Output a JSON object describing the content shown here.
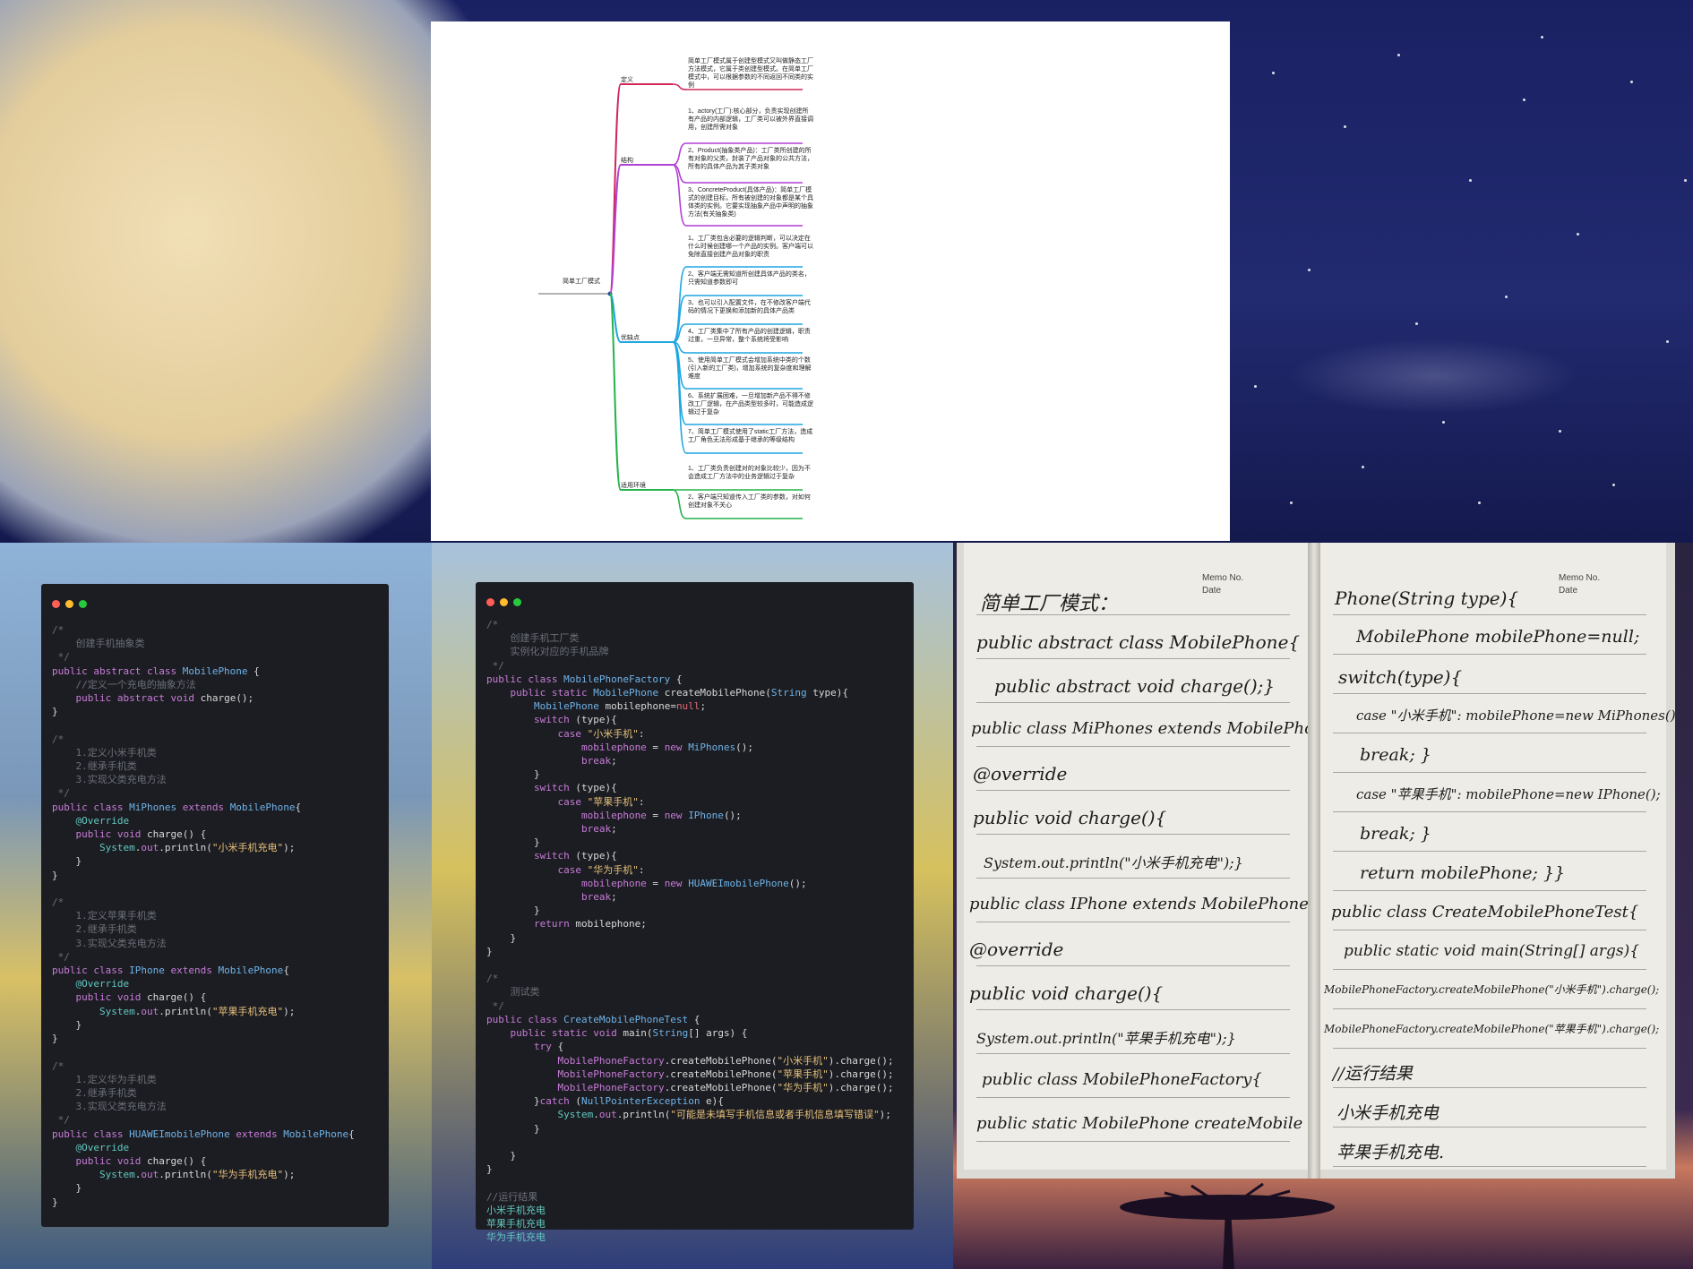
{
  "mindmap": {
    "root": "简单工厂模式",
    "branches": [
      {
        "label": "定义",
        "color": "#d0285a",
        "items": [
          "简单工厂模式属于创建型模式又叫做静态工厂方法模式，它属于类创建型模式。在简单工厂模式中，可以根据参数的不同返回不同类的实例"
        ]
      },
      {
        "label": "结构",
        "color": "#b23fd6",
        "items": [
          "1、actory(工厂):核心部分，负责实现创建所有产品的内部逻辑，工厂类可以被外界直接调用，创建所需对象",
          "2、Product(抽象类产品)：工厂类所创建的所有对象的父类，封装了产品对象的公共方法，所有的具体产品为其子类对象",
          "3、ConcreteProduct(具体产品)：简单工厂模式的创建目标，所有被创建的对象都是某个具体类的实例。它要实现抽象产品中声明的抽象方法(有关抽象类)"
        ]
      },
      {
        "label": "优缺点",
        "color": "#1ea6e0",
        "items": [
          "1、工厂类包含必要的逻辑判断，可以决定在什么时候创建哪一个产品的实例。客户端可以免除直接创建产品对象的职责",
          "2、客户端无需知道所创建具体产品的类名，只需知道参数即可",
          "3、也可以引入配置文件，在不修改客户端代码的情况下更换和添加新的具体产品类",
          "4、工厂类集中了所有产品的创建逻辑，职责过重，一旦异常，整个系统将受影响",
          "5、使用简单工厂模式会增加系统中类的个数(引入新的工厂类)，增加系统的复杂度和理解难度",
          "6、系统扩展困难，一旦增加新产品不得不修改工厂逻辑，在产品类型较多时，可能造成逻辑过于复杂",
          "7、简单工厂模式使用了static工厂方法，造成工厂角色无法形成基于继承的等级结构"
        ]
      },
      {
        "label": "适用环境",
        "color": "#23b24b",
        "items": [
          "1、工厂类负责创建对的对象比较少，因为不会造成工厂方法中的业务逻辑过于复杂",
          "2、客户端只知道传入工厂类的参数，对如何创建对象不关心"
        ]
      }
    ]
  },
  "code_left": [
    [
      [
        "cm",
        "/*"
      ]
    ],
    [
      [
        "cm",
        "    创建手机抽象类"
      ]
    ],
    [
      [
        "cm",
        " */"
      ]
    ],
    [
      [
        "kw",
        "public abstract class "
      ],
      [
        "cl",
        "MobilePhone"
      ],
      [
        "fn",
        " {"
      ]
    ],
    [
      [
        "cm",
        "    //定义一个充电的抽象方法"
      ]
    ],
    [
      [
        "kw",
        "    public abstract void "
      ],
      [
        "fn",
        "charge();"
      ]
    ],
    [
      [
        "fn",
        "}"
      ]
    ],
    [
      [
        "fn",
        ""
      ]
    ],
    [
      [
        "cm",
        "/*"
      ]
    ],
    [
      [
        "cm",
        "    1.定义小米手机类"
      ]
    ],
    [
      [
        "cm",
        "    2.继承手机类"
      ]
    ],
    [
      [
        "cm",
        "    3.实现父类充电方法"
      ]
    ],
    [
      [
        "cm",
        " */"
      ]
    ],
    [
      [
        "kw",
        "public class "
      ],
      [
        "cl",
        "MiPhones"
      ],
      [
        "kw",
        " extends "
      ],
      [
        "cl",
        "MobilePhone"
      ],
      [
        "fn",
        "{"
      ]
    ],
    [
      [
        "an",
        "    @Override"
      ]
    ],
    [
      [
        "kw",
        "    public void "
      ],
      [
        "fn",
        "charge() {"
      ]
    ],
    [
      [
        "an",
        "        System"
      ],
      [
        "fn",
        "."
      ],
      [
        "kw",
        "out"
      ],
      [
        "fn",
        ".println("
      ],
      [
        "st",
        "\"小米手机充电\""
      ],
      [
        "fn",
        ");"
      ]
    ],
    [
      [
        "fn",
        "    }"
      ]
    ],
    [
      [
        "fn",
        "}"
      ]
    ],
    [
      [
        "fn",
        ""
      ]
    ],
    [
      [
        "cm",
        "/*"
      ]
    ],
    [
      [
        "cm",
        "    1.定义苹果手机类"
      ]
    ],
    [
      [
        "cm",
        "    2.继承手机类"
      ]
    ],
    [
      [
        "cm",
        "    3.实现父类充电方法"
      ]
    ],
    [
      [
        "cm",
        " */"
      ]
    ],
    [
      [
        "kw",
        "public class "
      ],
      [
        "cl",
        "IPhone"
      ],
      [
        "kw",
        " extends "
      ],
      [
        "cl",
        "MobilePhone"
      ],
      [
        "fn",
        "{"
      ]
    ],
    [
      [
        "an",
        "    @Override"
      ]
    ],
    [
      [
        "kw",
        "    public void "
      ],
      [
        "fn",
        "charge() {"
      ]
    ],
    [
      [
        "an",
        "        System"
      ],
      [
        "fn",
        "."
      ],
      [
        "kw",
        "out"
      ],
      [
        "fn",
        ".println("
      ],
      [
        "st",
        "\"苹果手机充电\""
      ],
      [
        "fn",
        ");"
      ]
    ],
    [
      [
        "fn",
        "    }"
      ]
    ],
    [
      [
        "fn",
        "}"
      ]
    ],
    [
      [
        "fn",
        ""
      ]
    ],
    [
      [
        "cm",
        "/*"
      ]
    ],
    [
      [
        "cm",
        "    1.定义华为手机类"
      ]
    ],
    [
      [
        "cm",
        "    2.继承手机类"
      ]
    ],
    [
      [
        "cm",
        "    3.实现父类充电方法"
      ]
    ],
    [
      [
        "cm",
        " */"
      ]
    ],
    [
      [
        "kw",
        "public class "
      ],
      [
        "cl",
        "HUAWEImobilePhone"
      ],
      [
        "kw",
        " extends "
      ],
      [
        "cl",
        "MobilePhone"
      ],
      [
        "fn",
        "{"
      ]
    ],
    [
      [
        "an",
        "    @Override"
      ]
    ],
    [
      [
        "kw",
        "    public void "
      ],
      [
        "fn",
        "charge() {"
      ]
    ],
    [
      [
        "an",
        "        System"
      ],
      [
        "fn",
        "."
      ],
      [
        "kw",
        "out"
      ],
      [
        "fn",
        ".println("
      ],
      [
        "st",
        "\"华为手机充电\""
      ],
      [
        "fn",
        ");"
      ]
    ],
    [
      [
        "fn",
        "    }"
      ]
    ],
    [
      [
        "fn",
        "}"
      ]
    ]
  ],
  "code_middle": [
    [
      [
        "cm",
        "/*"
      ]
    ],
    [
      [
        "cm",
        "    创建手机工厂类"
      ]
    ],
    [
      [
        "cm",
        "    实例化对应的手机品牌"
      ]
    ],
    [
      [
        "cm",
        " */"
      ]
    ],
    [
      [
        "kw",
        "public class "
      ],
      [
        "cl",
        "MobilePhoneFactory"
      ],
      [
        "fn",
        " {"
      ]
    ],
    [
      [
        "kw",
        "    public static "
      ],
      [
        "cl",
        "MobilePhone"
      ],
      [
        "fn",
        " createMobilePhone("
      ],
      [
        "cl",
        "String"
      ],
      [
        "fn",
        " type){"
      ]
    ],
    [
      [
        "cl",
        "        MobilePhone"
      ],
      [
        "fn",
        " mobilephone="
      ],
      [
        "nl",
        "null"
      ],
      [
        "fn",
        ";"
      ]
    ],
    [
      [
        "kw",
        "        switch "
      ],
      [
        "fn",
        "(type){"
      ]
    ],
    [
      [
        "kw",
        "            case "
      ],
      [
        "st",
        "\"小米手机\""
      ],
      [
        "fn",
        ":"
      ]
    ],
    [
      [
        "kw",
        "                mobilephone"
      ],
      [
        "fn",
        " = "
      ],
      [
        "kw",
        "new "
      ],
      [
        "cl",
        "MiPhones"
      ],
      [
        "fn",
        "();"
      ]
    ],
    [
      [
        "kw",
        "                break"
      ],
      [
        "fn",
        ";"
      ]
    ],
    [
      [
        "fn",
        "        }"
      ]
    ],
    [
      [
        "kw",
        "        switch "
      ],
      [
        "fn",
        "(type){"
      ]
    ],
    [
      [
        "kw",
        "            case "
      ],
      [
        "st",
        "\"苹果手机\""
      ],
      [
        "fn",
        ":"
      ]
    ],
    [
      [
        "kw",
        "                mobilephone"
      ],
      [
        "fn",
        " = "
      ],
      [
        "kw",
        "new "
      ],
      [
        "cl",
        "IPhone"
      ],
      [
        "fn",
        "();"
      ]
    ],
    [
      [
        "kw",
        "                break"
      ],
      [
        "fn",
        ";"
      ]
    ],
    [
      [
        "fn",
        "        }"
      ]
    ],
    [
      [
        "kw",
        "        switch "
      ],
      [
        "fn",
        "(type){"
      ]
    ],
    [
      [
        "kw",
        "            case "
      ],
      [
        "st",
        "\"华为手机\""
      ],
      [
        "fn",
        ":"
      ]
    ],
    [
      [
        "kw",
        "                mobilephone"
      ],
      [
        "fn",
        " = "
      ],
      [
        "kw",
        "new "
      ],
      [
        "cl",
        "HUAWEImobilePhone"
      ],
      [
        "fn",
        "();"
      ]
    ],
    [
      [
        "kw",
        "                break"
      ],
      [
        "fn",
        ";"
      ]
    ],
    [
      [
        "fn",
        "        }"
      ]
    ],
    [
      [
        "kw",
        "        return "
      ],
      [
        "fn",
        "mobilephone;"
      ]
    ],
    [
      [
        "fn",
        "    }"
      ]
    ],
    [
      [
        "fn",
        "}"
      ]
    ],
    [
      [
        "fn",
        ""
      ]
    ],
    [
      [
        "cm",
        "/*"
      ]
    ],
    [
      [
        "cm",
        "    测试类"
      ]
    ],
    [
      [
        "cm",
        " */"
      ]
    ],
    [
      [
        "kw",
        "public class "
      ],
      [
        "cl",
        "CreateMobilePhoneTest"
      ],
      [
        "fn",
        " {"
      ]
    ],
    [
      [
        "kw",
        "    public static void "
      ],
      [
        "fn",
        "main("
      ],
      [
        "cl",
        "String"
      ],
      [
        "fn",
        "[] args) {"
      ]
    ],
    [
      [
        "kw",
        "        try "
      ],
      [
        "fn",
        "{"
      ]
    ],
    [
      [
        "kw",
        "            MobilePhoneFactory"
      ],
      [
        "fn",
        ".createMobilePhone("
      ],
      [
        "st",
        "\"小米手机\""
      ],
      [
        "fn",
        ").charge();"
      ]
    ],
    [
      [
        "kw",
        "            MobilePhoneFactory"
      ],
      [
        "fn",
        ".createMobilePhone("
      ],
      [
        "st",
        "\"苹果手机\""
      ],
      [
        "fn",
        ").charge();"
      ]
    ],
    [
      [
        "kw",
        "            MobilePhoneFactory"
      ],
      [
        "fn",
        ".createMobilePhone("
      ],
      [
        "st",
        "\"华为手机\""
      ],
      [
        "fn",
        ").charge();"
      ]
    ],
    [
      [
        "fn",
        "        }"
      ],
      [
        "kw",
        "catch "
      ],
      [
        "fn",
        "("
      ],
      [
        "cl",
        "NullPointerException"
      ],
      [
        "fn",
        " e){"
      ]
    ],
    [
      [
        "an",
        "            System"
      ],
      [
        "fn",
        "."
      ],
      [
        "kw",
        "out"
      ],
      [
        "fn",
        ".println("
      ],
      [
        "st",
        "\"可能是未填写手机信息或者手机信息填写错误\""
      ],
      [
        "fn",
        ");"
      ]
    ],
    [
      [
        "fn",
        "        }"
      ]
    ],
    [
      [
        "fn",
        ""
      ]
    ],
    [
      [
        "fn",
        "    }"
      ]
    ],
    [
      [
        "fn",
        "}"
      ]
    ],
    [
      [
        "fn",
        ""
      ]
    ],
    [
      [
        "cm",
        "//运行结果"
      ]
    ],
    [
      [
        "an",
        "小米手机充电"
      ]
    ],
    [
      [
        "an",
        "苹果手机充电"
      ]
    ],
    [
      [
        "an",
        "华为手机充电"
      ]
    ]
  ],
  "window_dots": {
    "red": "#ff5f56",
    "yellow": "#ffbd2e",
    "green": "#27c93f"
  },
  "notebook": {
    "memo_no": "Memo No.",
    "date": "Date",
    "left_page": [
      "简单工厂模式：",
      "public abstract class MobilePhone{",
      "public abstract void charge();}",
      "public class MiPhones extends MobilePhone{",
      "@override",
      "public void charge(){",
      "System.out.println(\"小米手机充电\");}",
      "public class IPhone extends MobilePhone{",
      "@override",
      "public void charge(){",
      "System.out.println(\"苹果手机充电\");}",
      "public class MobilePhoneFactory{",
      "public static MobilePhone createMobile"
    ],
    "right_page": [
      "Phone(String type){",
      "MobilePhone mobilePhone=null;",
      "switch(type){",
      "case \"小米手机\": mobilePhone=new MiPhones();",
      "break; }",
      "case \"苹果手机\": mobilePhone=new IPhone();",
      "break; }",
      "return mobilePhone; }}",
      "public class CreateMobilePhoneTest{",
      "public static void main(String[] args){",
      "MobilePhoneFactory.createMobilePhone(\"小米手机\").charge();",
      "MobilePhoneFactory.createMobilePhone(\"苹果手机\").charge();",
      "//运行结果",
      "小米手机充电",
      "苹果手机充电."
    ]
  }
}
